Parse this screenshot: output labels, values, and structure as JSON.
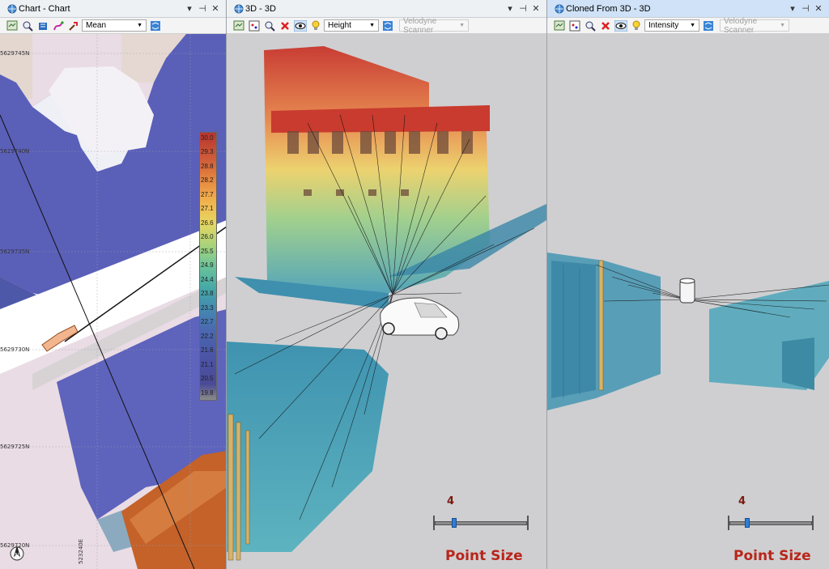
{
  "panels": {
    "chart": {
      "title": "Chart - Chart",
      "dropdown_value": "Mean",
      "northings": [
        "5629745N",
        "5629740N",
        "5629735N",
        "5629730N",
        "5629725N",
        "5629720N"
      ],
      "easting": "523240E",
      "colorbar_labels": [
        "30.0",
        "29.3",
        "28.8",
        "28.2",
        "27.7",
        "27.1",
        "26.6",
        "26.0",
        "25.5",
        "24.9",
        "24.4",
        "23.8",
        "23.3",
        "22.7",
        "22.2",
        "21.6",
        "21.1",
        "20.5",
        "19.8"
      ]
    },
    "view3d": {
      "title": "3D - 3D",
      "color_by": "Height",
      "scanner": "Velodyne Scanner",
      "point_size_value": "4",
      "point_size_label": "Point Size",
      "point_size_fraction": 0.17
    },
    "clone3d": {
      "title": "Cloned From 3D - 3D",
      "color_by": "Intensity",
      "scanner": "Velodyne Scanner",
      "point_size_value": "4",
      "point_size_label": "Point Size",
      "point_size_fraction": 0.17
    }
  },
  "window_controls": {
    "menu": "▾",
    "pin": "⊣",
    "close": "✕"
  },
  "colors": {
    "active_title": "#cfe2f7",
    "inactive_title": "#eef1f4",
    "accent_label": "#b8261a",
    "slider_thumb": "#2d7fd8"
  },
  "icons": [
    "globe-icon",
    "layer-icon",
    "zoom-icon",
    "pan-icon",
    "route-icon",
    "pick-icon",
    "stack-icon",
    "reset-icon",
    "delete-icon",
    "eye-icon",
    "light-icon",
    "north-arrow-icon"
  ]
}
